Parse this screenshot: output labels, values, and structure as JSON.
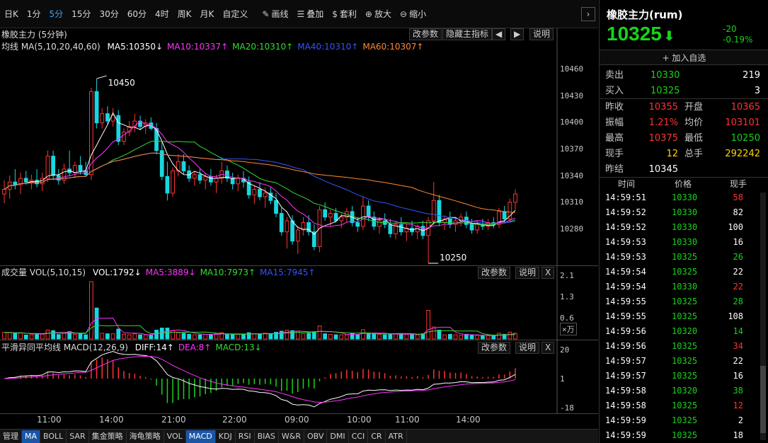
{
  "toolbar": {
    "periods": [
      "日K",
      "1分",
      "5分",
      "15分",
      "30分",
      "60分",
      "4时",
      "周K",
      "月K",
      "自定义"
    ],
    "active_period": "5分",
    "tools": [
      {
        "icon": "pencil-icon",
        "glyph": "✎",
        "label": "画线"
      },
      {
        "icon": "database-icon",
        "glyph": "☰",
        "label": "叠加"
      },
      {
        "icon": "money-bag-icon",
        "glyph": "$",
        "label": "套利"
      },
      {
        "icon": "zoom-in-icon",
        "glyph": "⊕",
        "label": "放大"
      },
      {
        "icon": "zoom-out-icon",
        "glyph": "⊖",
        "label": "缩小"
      }
    ],
    "collapse_arrow": "›"
  },
  "main_chart": {
    "title": "橡胶主力 (5分钟)",
    "buttons": {
      "params": "改参数",
      "hide": "隐藏主指标",
      "prev": "◀",
      "next": "▶",
      "help": "说明"
    },
    "ma_label": "均线 MA(5,10,20,40,60)",
    "ma_values": [
      {
        "text": "MA5:10350↓",
        "color": "#ffffff"
      },
      {
        "text": "MA10:10337↑",
        "color": "#ff33ff"
      },
      {
        "text": "MA20:10310↑",
        "color": "#33dd33"
      },
      {
        "text": "MA40:10310↑",
        "color": "#3355ff"
      },
      {
        "text": "MA60:10307↑",
        "color": "#ff8833"
      }
    ],
    "y_ticks": [
      "10460",
      "10430",
      "10400",
      "10370",
      "10340",
      "10310",
      "10280"
    ],
    "high_mark": "10450",
    "low_mark": "10250"
  },
  "volume_chart": {
    "title": "成交量 VOL(5,10,15)",
    "values": [
      {
        "text": "VOL:1792↓",
        "color": "#ffffff"
      },
      {
        "text": "MA5:3889↓",
        "color": "#ff33ff"
      },
      {
        "text": "MA10:7973↑",
        "color": "#33dd33"
      },
      {
        "text": "MA15:7945↑",
        "color": "#3355ff"
      }
    ],
    "buttons": {
      "params": "改参数",
      "help": "说明",
      "close": "X"
    },
    "y_ticks": [
      "2.1",
      "1.3",
      "0.6"
    ],
    "unit": "×万"
  },
  "macd_chart": {
    "title": "平滑异同平均线 MACD(12,26,9)",
    "values": [
      {
        "text": "DIFF:14↑",
        "color": "#ffffff"
      },
      {
        "text": "DEA:8↑",
        "color": "#ff33ff"
      },
      {
        "text": "MACD:13↓",
        "color": "#33dd33"
      }
    ],
    "buttons": {
      "params": "改参数",
      "help": "说明",
      "close": "X"
    },
    "y_ticks": [
      "20",
      "1",
      "-18"
    ]
  },
  "x_axis": [
    "11:00",
    "14:00",
    "21:00",
    "22:00",
    "09:00",
    "10:00",
    "11:00",
    "14:00"
  ],
  "bottom_tabs": [
    "管理",
    "MA",
    "BOLL",
    "SAR",
    "集金策略",
    "海龟策略",
    "VOL",
    "MACD",
    "KDJ",
    "RSI",
    "BIAS",
    "W&R",
    "OBV",
    "DMI",
    "CCI",
    "CR",
    "ATR"
  ],
  "bottom_active": [
    "MA",
    "MACD"
  ],
  "quote": {
    "name": "橡胶主力(rum)",
    "price": "10325",
    "arrow": "⬇",
    "change": "-20",
    "change_pct": "-0.19%",
    "add_watch": "+ 加入自选",
    "sell": {
      "label": "卖出",
      "price": "10330",
      "vol": "219"
    },
    "buy": {
      "label": "买入",
      "price": "10325",
      "vol": "3"
    },
    "stats": [
      {
        "l1": "昨收",
        "v1": "10355",
        "c1": "red",
        "l2": "开盘",
        "v2": "10365",
        "c2": "red"
      },
      {
        "l1": "振幅",
        "v1": "1.21%",
        "c1": "red",
        "l2": "均价",
        "v2": "103101",
        "c2": "red"
      },
      {
        "l1": "最高",
        "v1": "10375",
        "c1": "red",
        "l2": "最低",
        "v2": "10250",
        "c2": "green"
      },
      {
        "l1": "现手",
        "v1": "12",
        "c1": "yellow",
        "l2": "总手",
        "v2": "292242",
        "c2": "yellow"
      },
      {
        "l1": "昨结",
        "v1": "10345",
        "c1": "white",
        "l2": "",
        "v2": "",
        "c2": "white"
      }
    ],
    "colors": {
      "up": "#ff3333",
      "down": "#19d21b",
      "vol": "#ffd400"
    }
  },
  "ticks": {
    "headers": [
      "时间",
      "价格",
      "现手"
    ],
    "rows": [
      {
        "time": "14:59:51",
        "price": "10330",
        "vol": "58",
        "vc": "red"
      },
      {
        "time": "14:59:52",
        "price": "10330",
        "vol": "82",
        "vc": "white"
      },
      {
        "time": "14:59:52",
        "price": "10330",
        "vol": "100",
        "vc": "white"
      },
      {
        "time": "14:59:53",
        "price": "10330",
        "vol": "16",
        "vc": "white"
      },
      {
        "time": "14:59:53",
        "price": "10325",
        "vol": "26",
        "vc": "green"
      },
      {
        "time": "14:59:54",
        "price": "10325",
        "vol": "22",
        "vc": "white"
      },
      {
        "time": "14:59:54",
        "price": "10330",
        "vol": "22",
        "vc": "red"
      },
      {
        "time": "14:59:55",
        "price": "10325",
        "vol": "28",
        "vc": "green"
      },
      {
        "time": "14:59:55",
        "price": "10325",
        "vol": "108",
        "vc": "white"
      },
      {
        "time": "14:59:56",
        "price": "10320",
        "vol": "14",
        "vc": "green"
      },
      {
        "time": "14:59:56",
        "price": "10325",
        "vol": "34",
        "vc": "red"
      },
      {
        "time": "14:59:57",
        "price": "10325",
        "vol": "22",
        "vc": "white"
      },
      {
        "time": "14:59:57",
        "price": "10325",
        "vol": "16",
        "vc": "white"
      },
      {
        "time": "14:59:58",
        "price": "10320",
        "vol": "38",
        "vc": "green"
      },
      {
        "time": "14:59:58",
        "price": "10325",
        "vol": "12",
        "vc": "red"
      },
      {
        "time": "14:59:59",
        "price": "10325",
        "vol": "2",
        "vc": "white"
      },
      {
        "time": "14:59:59",
        "price": "10325",
        "vol": "18",
        "vc": "white"
      }
    ]
  },
  "chart_data": {
    "type": "candlestick",
    "instrument": "橡胶主力",
    "interval": "5分钟",
    "ylim": [
      10250,
      10460
    ],
    "candles": [
      {
        "o": 10325,
        "h": 10340,
        "l": 10315,
        "c": 10330
      },
      {
        "o": 10330,
        "h": 10345,
        "l": 10320,
        "c": 10338
      },
      {
        "o": 10338,
        "h": 10352,
        "l": 10330,
        "c": 10335
      },
      {
        "o": 10335,
        "h": 10348,
        "l": 10325,
        "c": 10342
      },
      {
        "o": 10342,
        "h": 10350,
        "l": 10335,
        "c": 10338
      },
      {
        "o": 10338,
        "h": 10346,
        "l": 10330,
        "c": 10340
      },
      {
        "o": 10340,
        "h": 10352,
        "l": 10332,
        "c": 10336
      },
      {
        "o": 10336,
        "h": 10348,
        "l": 10328,
        "c": 10342
      },
      {
        "o": 10342,
        "h": 10372,
        "l": 10338,
        "c": 10366
      },
      {
        "o": 10366,
        "h": 10372,
        "l": 10340,
        "c": 10345
      },
      {
        "o": 10345,
        "h": 10352,
        "l": 10335,
        "c": 10340
      },
      {
        "o": 10340,
        "h": 10358,
        "l": 10336,
        "c": 10352
      },
      {
        "o": 10352,
        "h": 10372,
        "l": 10344,
        "c": 10348
      },
      {
        "o": 10348,
        "h": 10360,
        "l": 10342,
        "c": 10356
      },
      {
        "o": 10356,
        "h": 10366,
        "l": 10346,
        "c": 10350
      },
      {
        "o": 10350,
        "h": 10360,
        "l": 10344,
        "c": 10346
      },
      {
        "o": 10346,
        "h": 10440,
        "l": 10340,
        "c": 10436
      },
      {
        "o": 10436,
        "h": 10450,
        "l": 10396,
        "c": 10402
      },
      {
        "o": 10402,
        "h": 10418,
        "l": 10396,
        "c": 10412
      },
      {
        "o": 10412,
        "h": 10420,
        "l": 10400,
        "c": 10404
      },
      {
        "o": 10404,
        "h": 10418,
        "l": 10398,
        "c": 10410
      },
      {
        "o": 10410,
        "h": 10416,
        "l": 10378,
        "c": 10382
      },
      {
        "o": 10382,
        "h": 10396,
        "l": 10378,
        "c": 10392
      },
      {
        "o": 10392,
        "h": 10404,
        "l": 10388,
        "c": 10398
      },
      {
        "o": 10398,
        "h": 10412,
        "l": 10392,
        "c": 10404
      },
      {
        "o": 10404,
        "h": 10410,
        "l": 10394,
        "c": 10398
      },
      {
        "o": 10398,
        "h": 10406,
        "l": 10390,
        "c": 10402
      },
      {
        "o": 10402,
        "h": 10408,
        "l": 10394,
        "c": 10396
      },
      {
        "o": 10396,
        "h": 10402,
        "l": 10368,
        "c": 10372
      },
      {
        "o": 10372,
        "h": 10382,
        "l": 10340,
        "c": 10344
      },
      {
        "o": 10344,
        "h": 10360,
        "l": 10318,
        "c": 10326
      },
      {
        "o": 10326,
        "h": 10354,
        "l": 10322,
        "c": 10350
      },
      {
        "o": 10350,
        "h": 10368,
        "l": 10344,
        "c": 10360
      },
      {
        "o": 10360,
        "h": 10368,
        "l": 10346,
        "c": 10350
      },
      {
        "o": 10350,
        "h": 10356,
        "l": 10338,
        "c": 10342
      },
      {
        "o": 10342,
        "h": 10350,
        "l": 10334,
        "c": 10346
      },
      {
        "o": 10346,
        "h": 10352,
        "l": 10336,
        "c": 10340
      },
      {
        "o": 10340,
        "h": 10348,
        "l": 10330,
        "c": 10344
      },
      {
        "o": 10344,
        "h": 10352,
        "l": 10334,
        "c": 10338
      },
      {
        "o": 10338,
        "h": 10346,
        "l": 10326,
        "c": 10342
      },
      {
        "o": 10342,
        "h": 10360,
        "l": 10336,
        "c": 10350
      },
      {
        "o": 10350,
        "h": 10356,
        "l": 10338,
        "c": 10342
      },
      {
        "o": 10342,
        "h": 10348,
        "l": 10330,
        "c": 10336
      },
      {
        "o": 10336,
        "h": 10346,
        "l": 10328,
        "c": 10342
      },
      {
        "o": 10342,
        "h": 10350,
        "l": 10332,
        "c": 10338
      },
      {
        "o": 10338,
        "h": 10344,
        "l": 10320,
        "c": 10324
      },
      {
        "o": 10324,
        "h": 10334,
        "l": 10314,
        "c": 10330
      },
      {
        "o": 10330,
        "h": 10338,
        "l": 10318,
        "c": 10322
      },
      {
        "o": 10322,
        "h": 10332,
        "l": 10310,
        "c": 10326
      },
      {
        "o": 10326,
        "h": 10332,
        "l": 10314,
        "c": 10318
      },
      {
        "o": 10318,
        "h": 10326,
        "l": 10300,
        "c": 10304
      },
      {
        "o": 10304,
        "h": 10310,
        "l": 10280,
        "c": 10284
      },
      {
        "o": 10284,
        "h": 10300,
        "l": 10266,
        "c": 10296
      },
      {
        "o": 10296,
        "h": 10302,
        "l": 10270,
        "c": 10274
      },
      {
        "o": 10274,
        "h": 10290,
        "l": 10260,
        "c": 10286
      },
      {
        "o": 10286,
        "h": 10300,
        "l": 10280,
        "c": 10294
      },
      {
        "o": 10294,
        "h": 10302,
        "l": 10280,
        "c": 10284
      },
      {
        "o": 10284,
        "h": 10292,
        "l": 10264,
        "c": 10268
      },
      {
        "o": 10268,
        "h": 10312,
        "l": 10262,
        "c": 10308
      },
      {
        "o": 10308,
        "h": 10316,
        "l": 10296,
        "c": 10300
      },
      {
        "o": 10300,
        "h": 10308,
        "l": 10290,
        "c": 10304
      },
      {
        "o": 10304,
        "h": 10310,
        "l": 10294,
        "c": 10296
      },
      {
        "o": 10296,
        "h": 10304,
        "l": 10288,
        "c": 10300
      },
      {
        "o": 10300,
        "h": 10310,
        "l": 10294,
        "c": 10306
      },
      {
        "o": 10306,
        "h": 10312,
        "l": 10290,
        "c": 10294
      },
      {
        "o": 10294,
        "h": 10300,
        "l": 10284,
        "c": 10290
      },
      {
        "o": 10290,
        "h": 10322,
        "l": 10286,
        "c": 10312
      },
      {
        "o": 10312,
        "h": 10318,
        "l": 10296,
        "c": 10300
      },
      {
        "o": 10300,
        "h": 10306,
        "l": 10286,
        "c": 10290
      },
      {
        "o": 10290,
        "h": 10300,
        "l": 10282,
        "c": 10296
      },
      {
        "o": 10296,
        "h": 10304,
        "l": 10288,
        "c": 10292
      },
      {
        "o": 10292,
        "h": 10298,
        "l": 10278,
        "c": 10282
      },
      {
        "o": 10282,
        "h": 10296,
        "l": 10276,
        "c": 10292
      },
      {
        "o": 10292,
        "h": 10300,
        "l": 10280,
        "c": 10284
      },
      {
        "o": 10284,
        "h": 10292,
        "l": 10274,
        "c": 10288
      },
      {
        "o": 10288,
        "h": 10296,
        "l": 10280,
        "c": 10284
      },
      {
        "o": 10284,
        "h": 10292,
        "l": 10276,
        "c": 10290
      },
      {
        "o": 10290,
        "h": 10296,
        "l": 10276,
        "c": 10280
      },
      {
        "o": 10280,
        "h": 10300,
        "l": 10250,
        "c": 10296
      },
      {
        "o": 10296,
        "h": 10338,
        "l": 10292,
        "c": 10318
      },
      {
        "o": 10318,
        "h": 10324,
        "l": 10290,
        "c": 10294
      },
      {
        "o": 10294,
        "h": 10302,
        "l": 10286,
        "c": 10298
      },
      {
        "o": 10298,
        "h": 10306,
        "l": 10288,
        "c": 10292
      },
      {
        "o": 10292,
        "h": 10300,
        "l": 10284,
        "c": 10296
      },
      {
        "o": 10296,
        "h": 10304,
        "l": 10290,
        "c": 10300
      },
      {
        "o": 10300,
        "h": 10306,
        "l": 10288,
        "c": 10292
      },
      {
        "o": 10292,
        "h": 10298,
        "l": 10282,
        "c": 10286
      },
      {
        "o": 10286,
        "h": 10296,
        "l": 10282,
        "c": 10292
      },
      {
        "o": 10292,
        "h": 10298,
        "l": 10286,
        "c": 10290
      },
      {
        "o": 10290,
        "h": 10298,
        "l": 10286,
        "c": 10294
      },
      {
        "o": 10294,
        "h": 10300,
        "l": 10288,
        "c": 10292
      },
      {
        "o": 10292,
        "h": 10310,
        "l": 10288,
        "c": 10306
      },
      {
        "o": 10306,
        "h": 10312,
        "l": 10294,
        "c": 10298
      },
      {
        "o": 10298,
        "h": 10320,
        "l": 10294,
        "c": 10316
      },
      {
        "o": 10316,
        "h": 10330,
        "l": 10308,
        "c": 10325
      }
    ]
  }
}
